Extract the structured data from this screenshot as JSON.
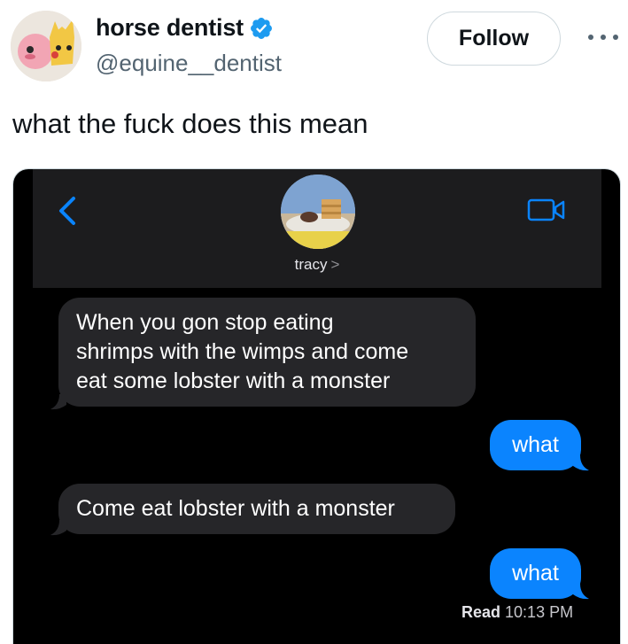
{
  "tweet": {
    "display_name": "horse dentist",
    "handle": "@equine__dentist",
    "follow_label": "Follow",
    "text": "what the fuck does this mean",
    "verified_color": "#1d9bf0"
  },
  "messages_screen": {
    "contact_name": "tracy",
    "contact_chevron": ">",
    "messages": [
      {
        "direction": "incoming",
        "text_lines": [
          "When you gon stop eating",
          "shrimps with the wimps and come",
          "eat some lobster with a monster"
        ]
      },
      {
        "direction": "outgoing",
        "text": "what"
      },
      {
        "direction": "incoming",
        "text": "Come eat lobster with a monster"
      },
      {
        "direction": "outgoing",
        "text": "what"
      }
    ],
    "read_label": "Read",
    "read_time": "10:13 PM",
    "colors": {
      "incoming_bubble": "#262629",
      "outgoing_bubble": "#0b84fe",
      "accent_blue": "#0a84ff"
    }
  },
  "icons": [
    "avatar-image",
    "verified-badge-icon",
    "more-icon",
    "back-chevron-icon",
    "video-call-icon"
  ]
}
